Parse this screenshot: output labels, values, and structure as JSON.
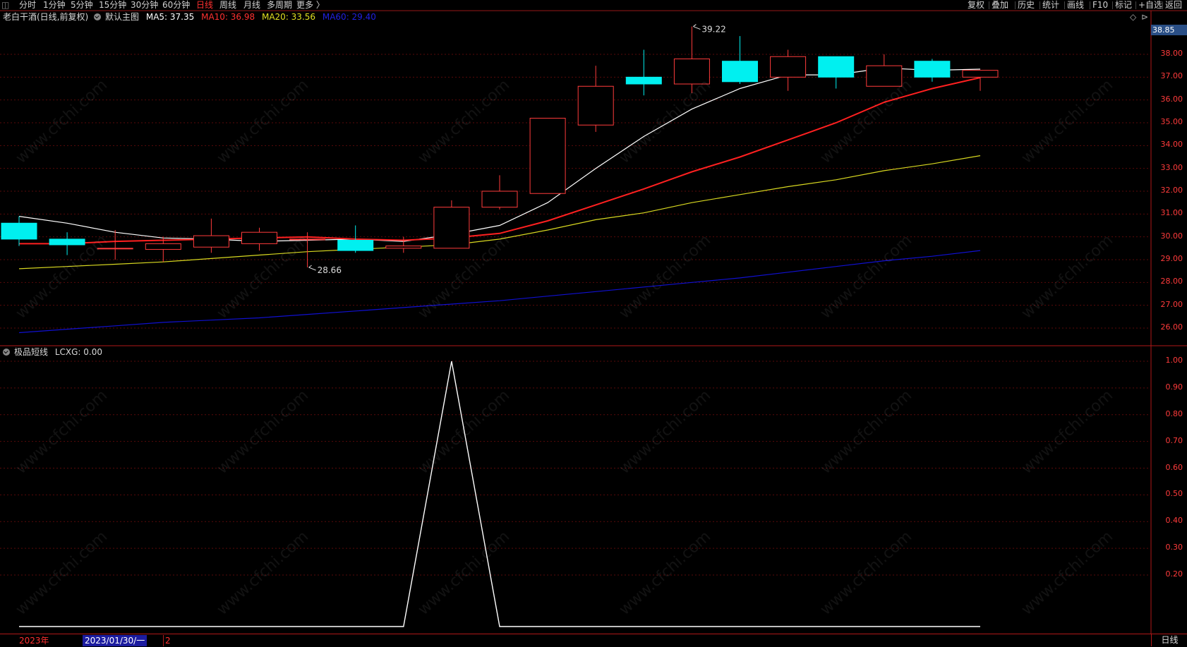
{
  "toolbar": {
    "left_items": [
      {
        "label": "分时",
        "active": false
      },
      {
        "label": "1分钟",
        "active": false
      },
      {
        "label": "5分钟",
        "active": false
      },
      {
        "label": "15分钟",
        "active": false
      },
      {
        "label": "30分钟",
        "active": false
      },
      {
        "label": "60分钟",
        "active": false
      },
      {
        "label": "日线",
        "active": true
      },
      {
        "label": "周线",
        "active": false
      },
      {
        "label": "月线",
        "active": false
      },
      {
        "label": "多周期",
        "active": false
      },
      {
        "label": "更多 〉",
        "active": false
      }
    ],
    "right_items": [
      "复权",
      "叠加",
      "历史",
      "统计",
      "画线",
      "F10",
      "标记",
      "+自选",
      "返回"
    ]
  },
  "main_legend": {
    "stock": "老白干酒(日线,前复权)",
    "indicator": "默认主图",
    "ma5": "MA5: 37.35",
    "ma10": "MA10: 36.98",
    "ma20": "MA20: 33.56",
    "ma60": "MA60: 29.40"
  },
  "sub_legend": {
    "indicator": "极品短线",
    "value": "LCXG: 0.00"
  },
  "current_price_tag": "38.85",
  "bottom": {
    "year": "2023年",
    "date": "2023/01/30/一",
    "marker": "2",
    "period_button": "日线"
  },
  "watermark_text": "www.cfchi.com",
  "colors": {
    "up": "#ff3b3b",
    "down": "#00f0f0",
    "ma5": "#ffffff",
    "ma10": "#ff2020",
    "ma20": "#d8d820",
    "ma60": "#1010d0",
    "axis": "#ff3b3b",
    "grid": "#5a0a0a"
  },
  "chart_data": [
    {
      "type": "candlestick",
      "title": "老白干酒(日线,前复权)",
      "ylim": [
        25.6,
        39.6
      ],
      "y_ticks": [
        "38.00",
        "37.00",
        "36.00",
        "35.00",
        "34.00",
        "33.00",
        "32.00",
        "31.00",
        "30.00",
        "29.00",
        "28.00",
        "27.00",
        "26.00"
      ],
      "y_tick_values": [
        38,
        37,
        36,
        35,
        34,
        33,
        32,
        31,
        30,
        29,
        28,
        27,
        26
      ],
      "annotations": [
        {
          "text": "39.22",
          "value": 39.22,
          "bar": 14
        },
        {
          "text": "28.66",
          "value": 28.66,
          "bar": 6
        }
      ],
      "candles": [
        {
          "o": 30.6,
          "c": 29.9,
          "h": 30.9,
          "l": 29.6
        },
        {
          "o": 29.9,
          "c": 29.65,
          "h": 30.2,
          "l": 29.2
        },
        {
          "o": 29.5,
          "c": 29.5,
          "h": 30.3,
          "l": 29.0
        },
        {
          "o": 29.45,
          "c": 29.7,
          "h": 30.0,
          "l": 28.9
        },
        {
          "o": 29.55,
          "c": 30.05,
          "h": 30.8,
          "l": 29.3
        },
        {
          "o": 29.7,
          "c": 30.2,
          "h": 30.4,
          "l": 29.4
        },
        {
          "o": 29.9,
          "c": 29.9,
          "h": 30.2,
          "l": 28.66
        },
        {
          "o": 29.85,
          "c": 29.4,
          "h": 30.5,
          "l": 29.3
        },
        {
          "o": 29.5,
          "c": 29.6,
          "h": 30.0,
          "l": 29.3
        },
        {
          "o": 29.5,
          "c": 31.3,
          "h": 31.6,
          "l": 29.5
        },
        {
          "o": 31.3,
          "c": 32.0,
          "h": 32.7,
          "l": 31.2
        },
        {
          "o": 31.9,
          "c": 35.2,
          "h": 35.2,
          "l": 31.9
        },
        {
          "o": 34.9,
          "c": 36.6,
          "h": 37.5,
          "l": 34.6
        },
        {
          "o": 37.0,
          "c": 36.7,
          "h": 38.2,
          "l": 36.2
        },
        {
          "o": 36.7,
          "c": 37.8,
          "h": 39.22,
          "l": 36.3
        },
        {
          "o": 37.7,
          "c": 36.8,
          "h": 38.8,
          "l": 36.7
        },
        {
          "o": 37.0,
          "c": 37.9,
          "h": 38.2,
          "l": 36.4
        },
        {
          "o": 37.9,
          "c": 37.0,
          "h": 37.9,
          "l": 36.5
        },
        {
          "o": 36.6,
          "c": 37.5,
          "h": 38.0,
          "l": 36.6
        },
        {
          "o": 37.7,
          "c": 37.0,
          "h": 37.8,
          "l": 36.8
        },
        {
          "o": 37.0,
          "c": 37.3,
          "h": 37.3,
          "l": 36.4
        }
      ],
      "series": [
        {
          "name": "MA5",
          "values": [
            30.9,
            30.6,
            30.2,
            29.95,
            29.9,
            29.8,
            29.85,
            29.9,
            29.8,
            30.1,
            30.5,
            31.5,
            33.0,
            34.4,
            35.6,
            36.5,
            37.1,
            37.1,
            37.4,
            37.3,
            37.35
          ]
        },
        {
          "name": "MA10",
          "values": [
            29.7,
            29.7,
            29.8,
            29.85,
            29.9,
            29.95,
            30.0,
            29.9,
            29.85,
            29.95,
            30.15,
            30.7,
            31.4,
            32.1,
            32.85,
            33.5,
            34.25,
            35.0,
            35.9,
            36.5,
            36.98
          ]
        },
        {
          "name": "MA20",
          "values": [
            28.6,
            28.7,
            28.8,
            28.9,
            29.05,
            29.2,
            29.35,
            29.45,
            29.55,
            29.65,
            29.9,
            30.3,
            30.75,
            31.05,
            31.5,
            31.85,
            32.2,
            32.5,
            32.9,
            33.2,
            33.56
          ]
        },
        {
          "name": "MA60",
          "values": [
            25.8,
            25.95,
            26.1,
            26.25,
            26.35,
            26.45,
            26.6,
            26.75,
            26.9,
            27.05,
            27.2,
            27.4,
            27.6,
            27.8,
            28.0,
            28.2,
            28.45,
            28.7,
            28.95,
            29.15,
            29.4
          ]
        }
      ]
    },
    {
      "type": "line",
      "title": "极品短线",
      "ylim": [
        0,
        1.05
      ],
      "y_ticks": [
        "1.00",
        "0.90",
        "0.80",
        "0.70",
        "0.60",
        "0.50",
        "0.40",
        "0.30",
        "0.20"
      ],
      "y_tick_values": [
        1.0,
        0.9,
        0.8,
        0.7,
        0.6,
        0.5,
        0.4,
        0.3,
        0.2
      ],
      "series": [
        {
          "name": "LCXG",
          "values": [
            0,
            0,
            0,
            0,
            0,
            0,
            0,
            0,
            0,
            1,
            0,
            0,
            0,
            0,
            0,
            0,
            0,
            0,
            0,
            0,
            0
          ]
        }
      ]
    }
  ]
}
